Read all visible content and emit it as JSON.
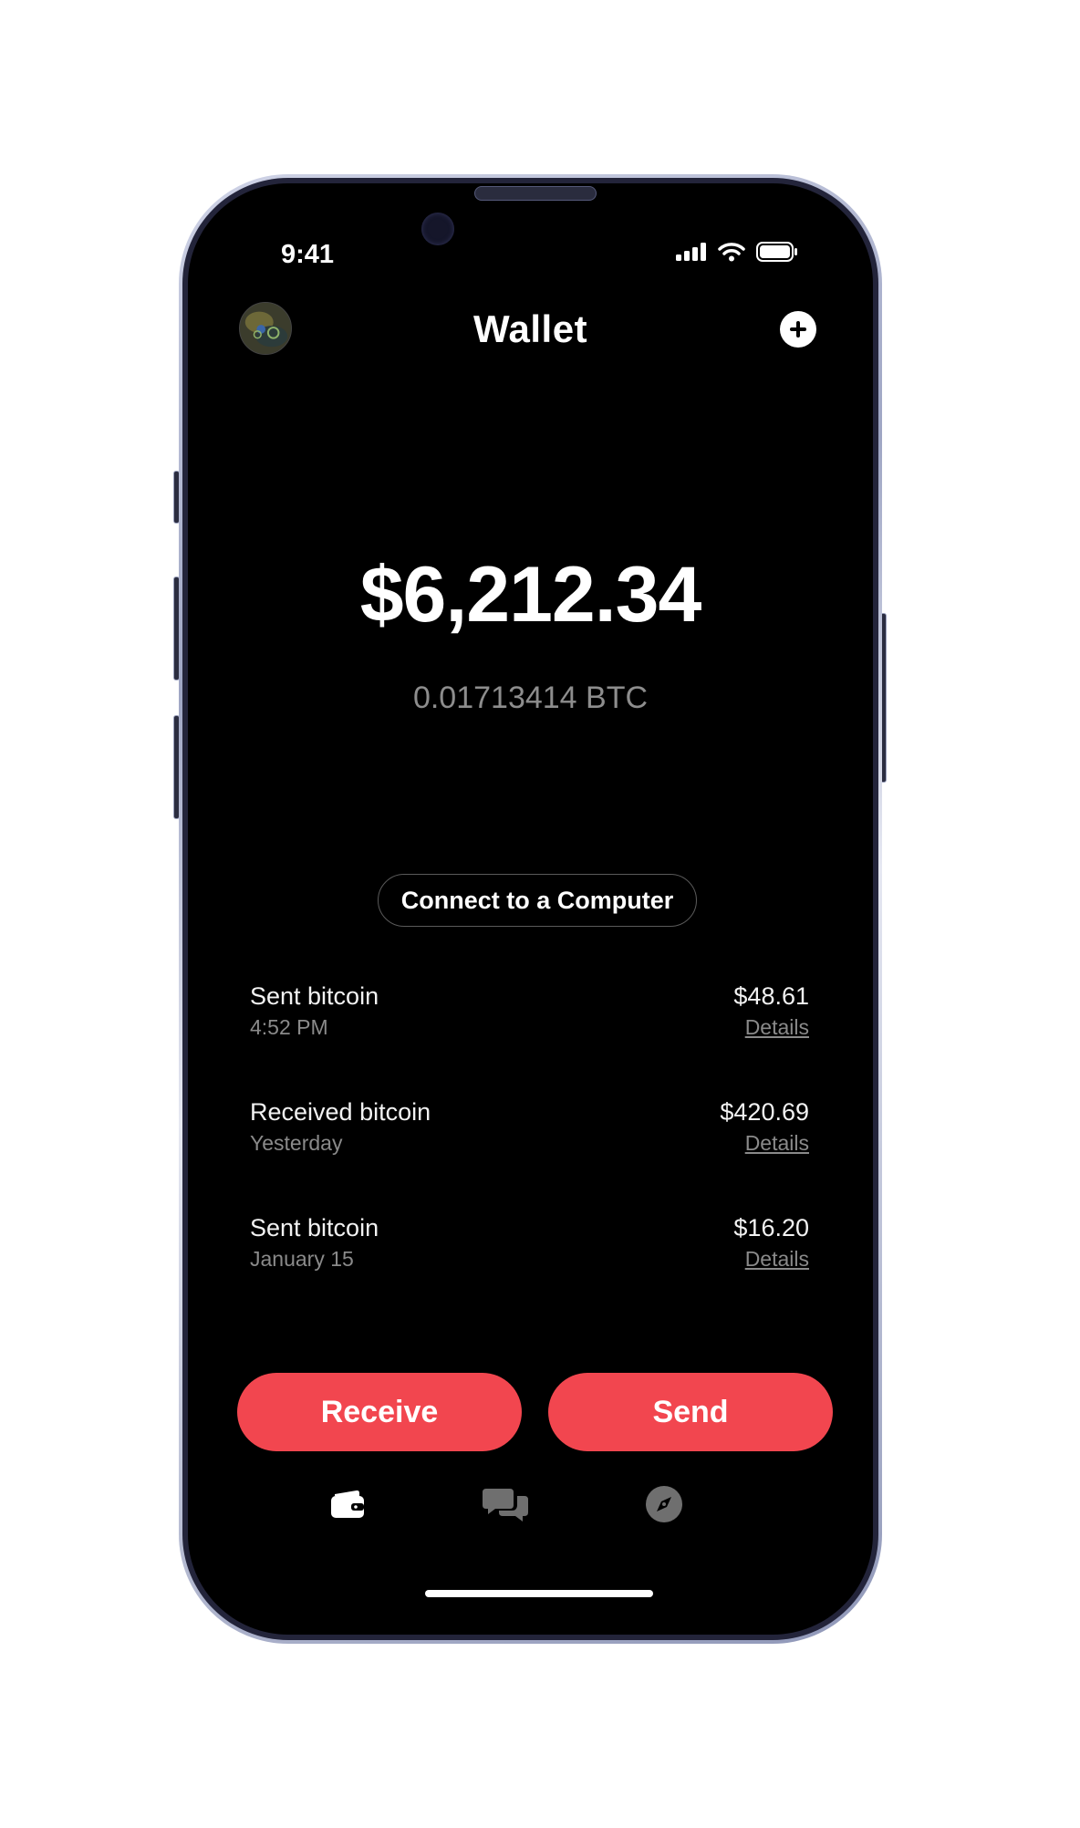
{
  "status_bar": {
    "time": "9:41"
  },
  "header": {
    "title": "Wallet"
  },
  "balance": {
    "usd": "$6,212.34",
    "btc": "0.01713414  BTC"
  },
  "connect": {
    "label": "Connect to a Computer"
  },
  "transactions": [
    {
      "title": "Sent bitcoin",
      "time": "4:52 PM",
      "amount": "$48.61",
      "details": "Details"
    },
    {
      "title": "Received bitcoin",
      "time": "Yesterday",
      "amount": "$420.69",
      "details": "Details"
    },
    {
      "title": "Sent bitcoin",
      "time": "January 15",
      "amount": "$16.20",
      "details": "Details"
    }
  ],
  "actions": {
    "receive": "Receive",
    "send": "Send"
  },
  "tabs": [
    {
      "icon": "wallet-icon",
      "active": true
    },
    {
      "icon": "chat-icon",
      "active": false
    },
    {
      "icon": "compass-icon",
      "active": false
    }
  ],
  "colors": {
    "accent": "#f2464f",
    "background": "#000000",
    "muted_text": "#8a8a8a"
  }
}
